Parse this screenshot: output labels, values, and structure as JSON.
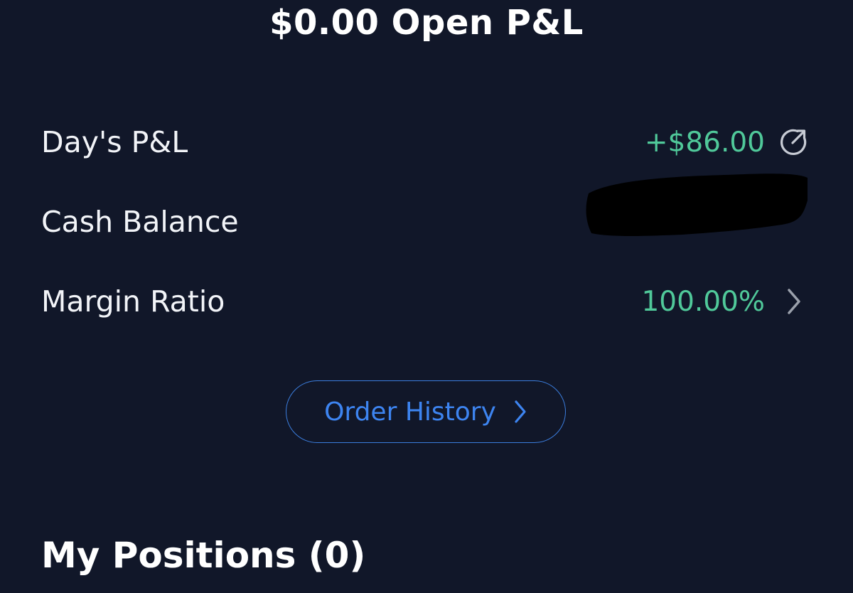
{
  "header": {
    "title": "$0.00 Open P&L"
  },
  "account": {
    "rows": [
      {
        "label": "Day's P&L",
        "value": "+$86.00",
        "icon": "share-arrow-icon"
      },
      {
        "label": "Cash Balance",
        "value": "",
        "redacted": true
      },
      {
        "label": "Margin Ratio",
        "value": "100.00%",
        "icon": "chevron-right-icon"
      }
    ]
  },
  "order_history": {
    "label": "Order History",
    "icon": "chevron-right-icon"
  },
  "positions": {
    "title": "My Positions (0)"
  },
  "colors": {
    "background": "#111729",
    "positive": "#50c99a",
    "link": "#3d84f0",
    "icon_gray": "#c7cbd4"
  }
}
